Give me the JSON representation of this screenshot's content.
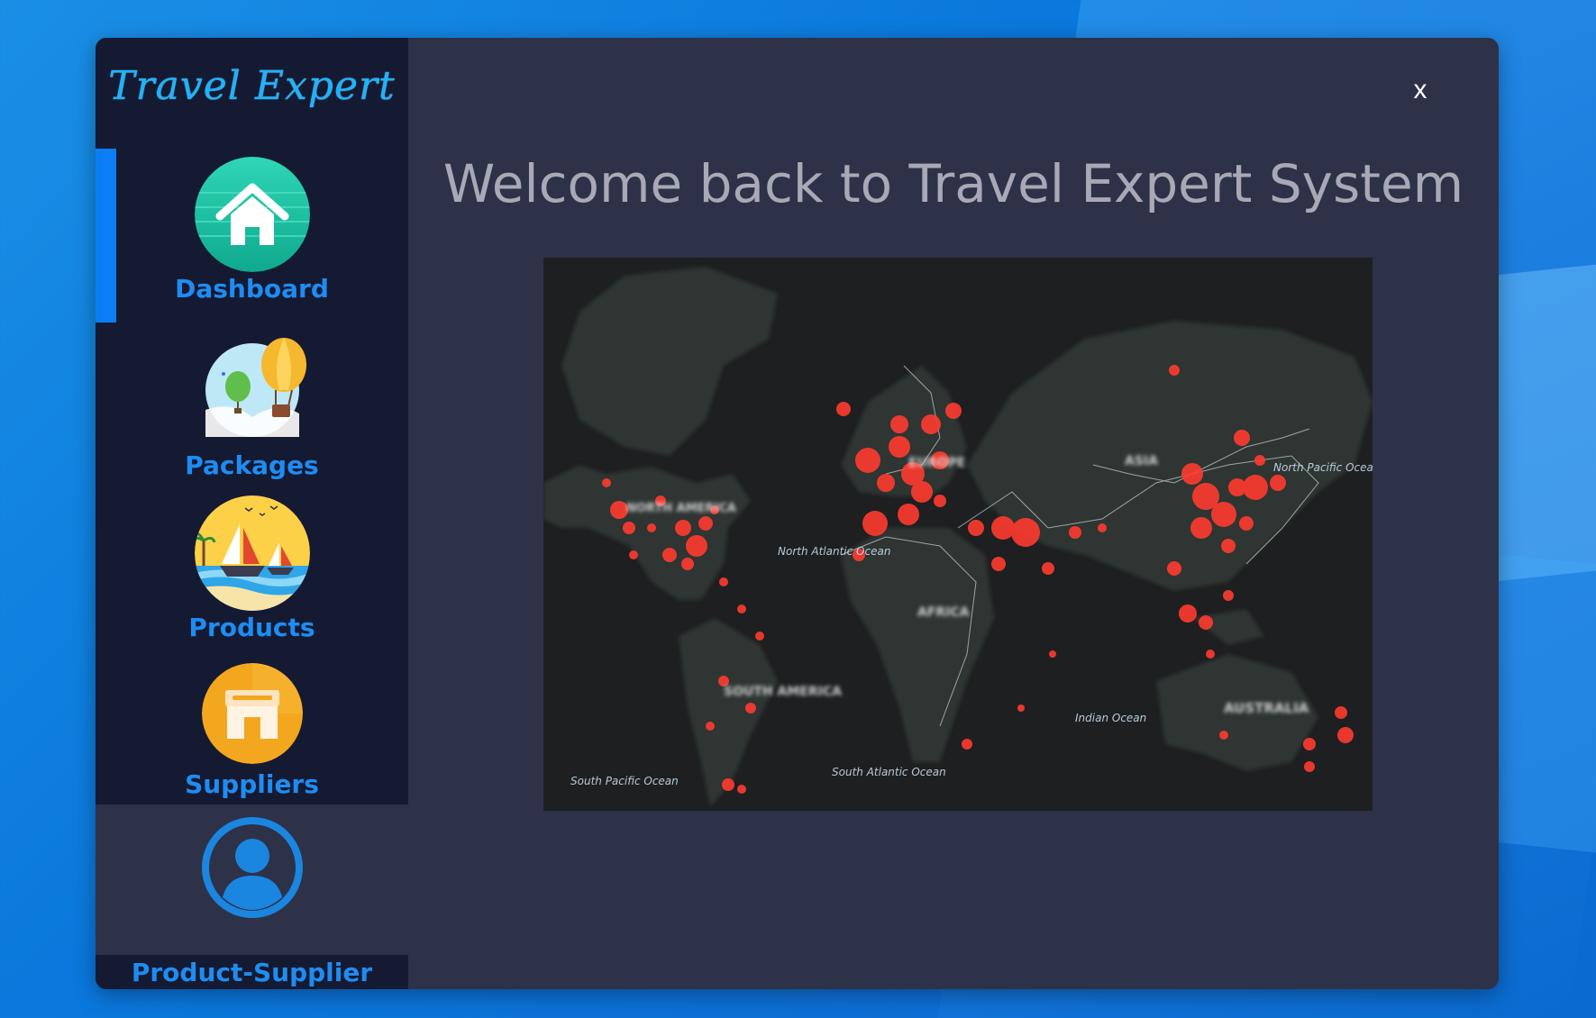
{
  "app": {
    "logo_text": "Travel Expert",
    "close_label": "x"
  },
  "sidebar": {
    "items": [
      {
        "label": "Dashboard",
        "icon": "home-icon",
        "active": true
      },
      {
        "label": "Packages",
        "icon": "hot-air-balloon-icon",
        "active": false
      },
      {
        "label": "Products",
        "icon": "sailboat-icon",
        "active": false
      },
      {
        "label": "Suppliers",
        "icon": "store-icon",
        "active": false
      },
      {
        "label": "Product-Supplier",
        "icon": "user-icon",
        "active": false
      }
    ]
  },
  "main": {
    "heading": "Welcome back to Travel Expert System",
    "map": {
      "labels": {
        "north_america": "NORTH AMERICA",
        "south_america": "SOUTH AMERICA",
        "europe": "EUROPE",
        "africa": "AFRICA",
        "asia": "ASIA",
        "australia": "AUSTRALIA",
        "north_atlantic": "North Atlantic Ocean",
        "south_atlantic": "South Atlantic Ocean",
        "indian": "Indian Ocean",
        "north_pacific": "North Pacific Ocean",
        "south_pacific": "South Pacific Ocean"
      }
    }
  },
  "colors": {
    "accent": "#1f8cf2",
    "sidebar_bg": "#151a33",
    "main_bg": "#2d3248",
    "active_indicator": "#0c7ef5",
    "map_dot": "#ff3b2f"
  }
}
